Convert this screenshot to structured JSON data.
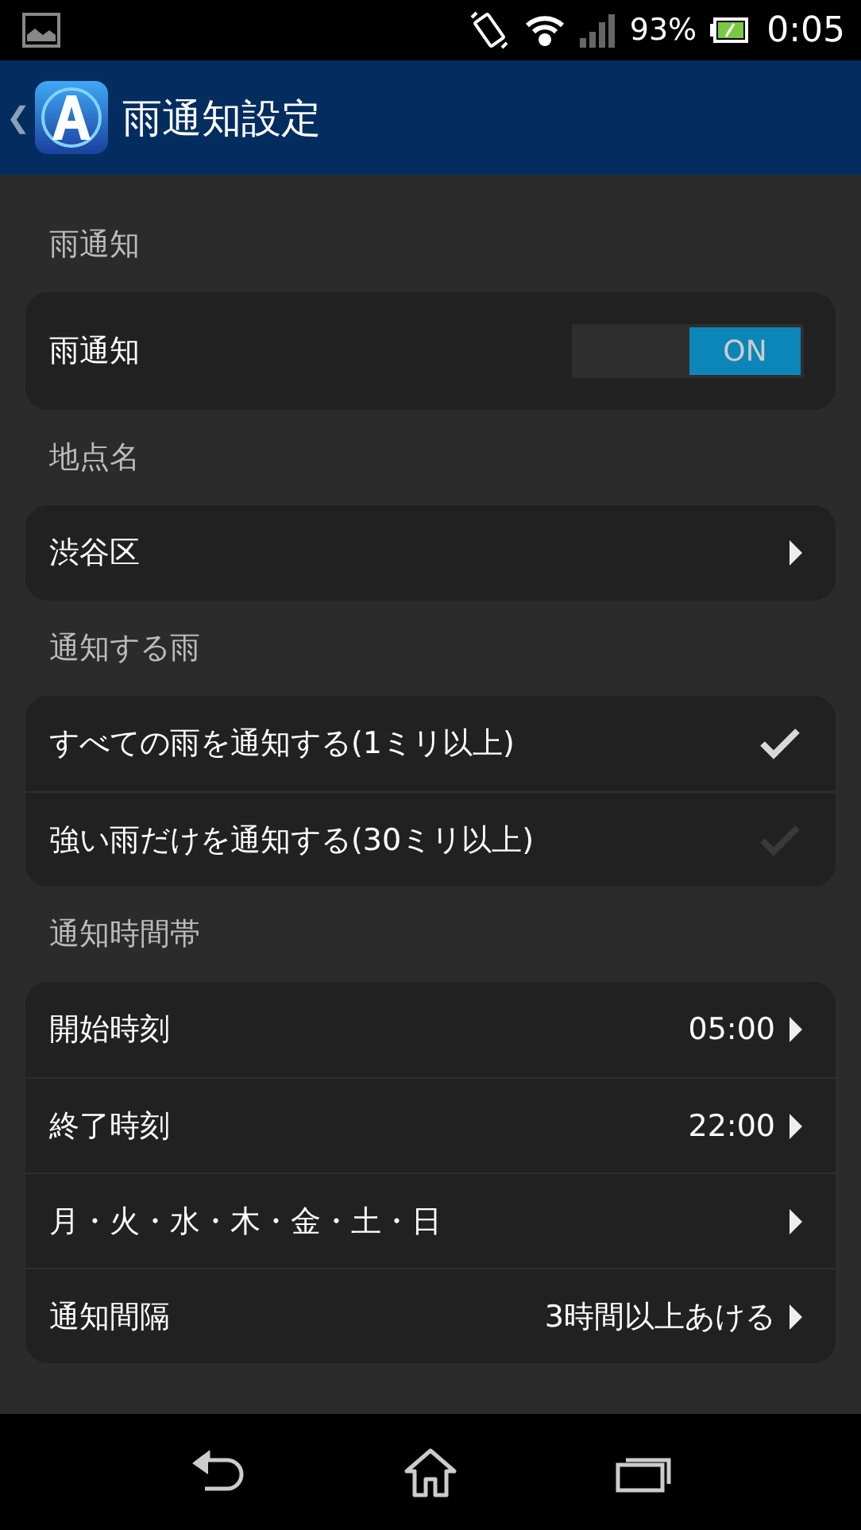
{
  "status_bar": {
    "battery": "93%",
    "time": "0:05"
  },
  "app_bar": {
    "back": "❮",
    "title": "雨通知設定"
  },
  "sections": [
    {
      "header": "雨通知",
      "rows": [
        {
          "kind": "toggle",
          "label": "雨通知",
          "on": true,
          "on_label": "ON"
        }
      ]
    },
    {
      "header": "地点名",
      "rows": [
        {
          "kind": "link",
          "label": "渋谷区"
        }
      ]
    },
    {
      "header": "通知する雨",
      "rows": [
        {
          "kind": "check",
          "label": "すべての雨を通知する(1ミリ以上)",
          "checked": true
        },
        {
          "kind": "check",
          "label": "強い雨だけを通知する(30ミリ以上)",
          "checked": false
        }
      ]
    },
    {
      "header": "通知時間帯",
      "rows": [
        {
          "kind": "link",
          "label": "開始時刻",
          "value": "05:00"
        },
        {
          "kind": "link",
          "label": "終了時刻",
          "value": "22:00"
        },
        {
          "kind": "link",
          "label": "月・火・水・木・金・土・日"
        },
        {
          "kind": "link",
          "label": "通知間隔",
          "value": "3時間以上あける"
        }
      ]
    }
  ]
}
